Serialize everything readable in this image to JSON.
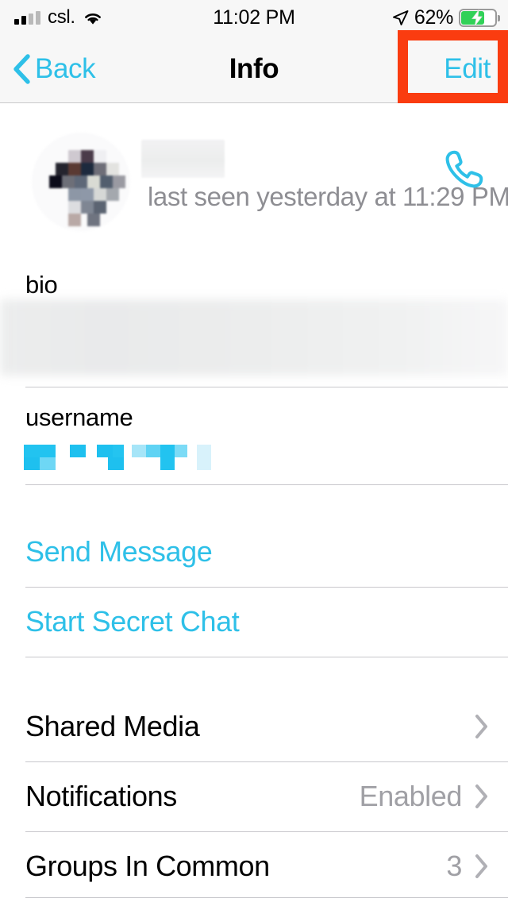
{
  "status_bar": {
    "carrier": "csl.",
    "time": "11:02 PM",
    "battery_percent": "62%",
    "battery_level": 62,
    "charging": true,
    "signal_bars_active": 2,
    "signal_bars_total": 4,
    "wifi_icon": "wifi-icon",
    "location_icon": "location-arrow-icon",
    "battery_icon": "battery-charging-icon"
  },
  "nav": {
    "back_label": "Back",
    "back_icon": "chevron-left-icon",
    "title": "Info",
    "edit_label": "Edit",
    "highlight_color": "#fa3c10"
  },
  "profile": {
    "name": "",
    "name_redacted": true,
    "avatar_redacted": true,
    "last_seen": "last seen yesterday at 11:29 PM",
    "call_icon": "phone-icon"
  },
  "fields": {
    "bio_label": "bio",
    "bio_value": "",
    "bio_redacted": true,
    "username_label": "username",
    "username_value": "",
    "username_redacted": true
  },
  "actions": [
    {
      "label": "Send Message",
      "name": "send-message-row"
    },
    {
      "label": "Start Secret Chat",
      "name": "start-secret-chat-row"
    }
  ],
  "menu": [
    {
      "label": "Shared Media",
      "value": "",
      "name": "shared-media-row"
    },
    {
      "label": "Notifications",
      "value": "Enabled",
      "name": "notifications-row"
    },
    {
      "label": "Groups In Common",
      "value": "3",
      "name": "groups-in-common-row"
    }
  ],
  "colors": {
    "accent": "#2ec0e8",
    "highlight": "#fa3c10",
    "bar_bg": "#f7f7f7",
    "separator": "#c8c7cc",
    "secondary_text": "#8e8e93"
  }
}
